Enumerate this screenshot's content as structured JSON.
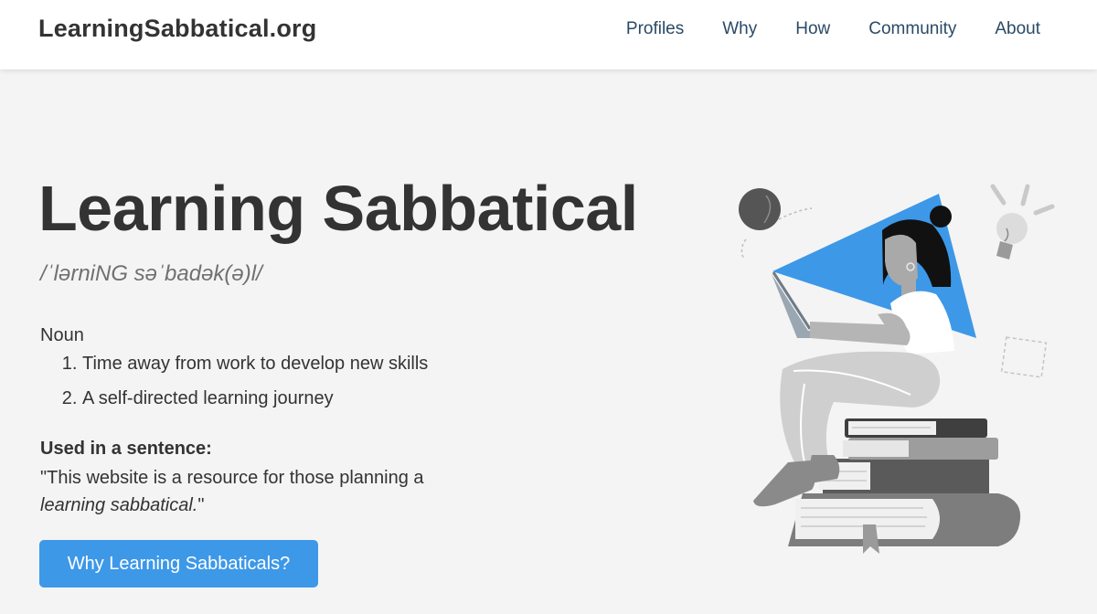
{
  "header": {
    "brand": "LearningSabbatical.org",
    "nav": [
      {
        "label": "Profiles"
      },
      {
        "label": "Why"
      },
      {
        "label": "How"
      },
      {
        "label": "Community"
      },
      {
        "label": "About"
      }
    ]
  },
  "hero": {
    "title": "Learning Sabbatical",
    "pronunciation": "/ˈlərniNG səˈbadək(ə)l/",
    "part_of_speech": "Noun",
    "definitions": [
      "Time away from work to develop new skills",
      "A self-directed learning journey"
    ],
    "sentence_label": "Used in a sentence:",
    "sentence_before": "\"This website is a resource for those planning a ",
    "sentence_emphasis": "learning sabbatical.",
    "sentence_after": "\"",
    "cta_label": "Why Learning Sabbaticals?"
  },
  "colors": {
    "accent": "#3d98e8",
    "nav_text": "#2a4a66",
    "background": "#f4f4f4",
    "text": "#333333"
  },
  "illustration": {
    "subject": "person-sitting-on-books-with-laptop-illustration",
    "icons": [
      "lightbulb-icon"
    ]
  }
}
